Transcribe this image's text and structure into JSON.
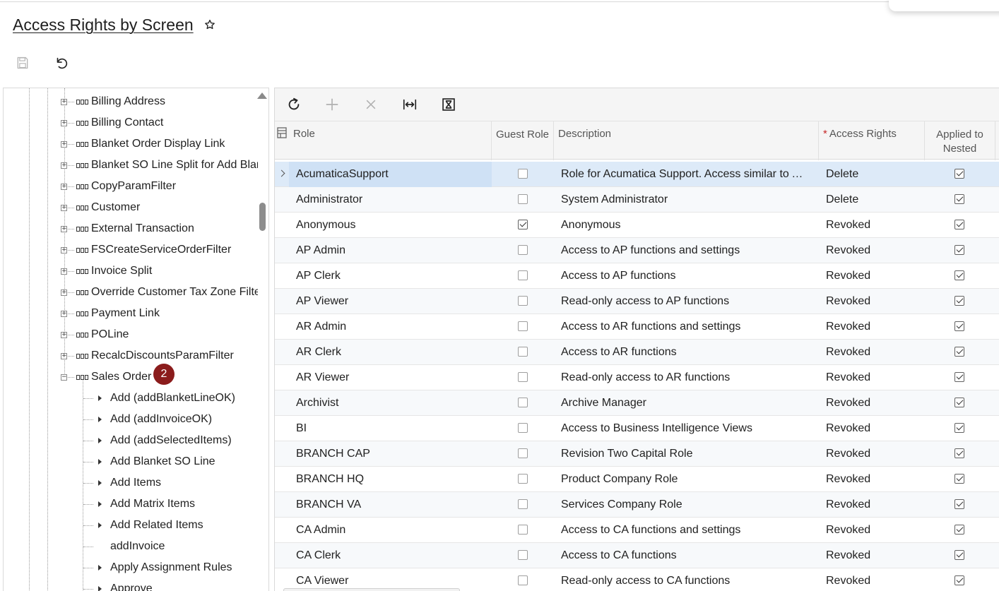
{
  "page": {
    "title": "Access Rights by Screen",
    "icons": {
      "favorite": "star-outline-icon",
      "save": "save-icon",
      "undo": "undo-icon"
    }
  },
  "tree": {
    "tables": [
      {
        "label": "Billing Address",
        "expanded": false
      },
      {
        "label": "Billing Contact",
        "expanded": false
      },
      {
        "label": "Blanket Order Display Link",
        "expanded": false
      },
      {
        "label": "Blanket SO Line Split for Add Blanket",
        "expanded": false
      },
      {
        "label": "CopyParamFilter",
        "expanded": false
      },
      {
        "label": "Customer",
        "expanded": false
      },
      {
        "label": "External Transaction",
        "expanded": false
      },
      {
        "label": "FSCreateServiceOrderFilter",
        "expanded": false
      },
      {
        "label": "Invoice Split",
        "expanded": false
      },
      {
        "label": "Override Customer Tax Zone Filter",
        "expanded": false
      },
      {
        "label": "Payment Link",
        "expanded": false
      },
      {
        "label": "POLine",
        "expanded": false
      },
      {
        "label": "RecalcDiscountsParamFilter",
        "expanded": false
      },
      {
        "label": "Sales Order",
        "expanded": true,
        "badge": "2"
      }
    ],
    "actions": [
      {
        "label": "Add (addBlanketLineOK)",
        "has_children": true
      },
      {
        "label": "Add (addInvoiceOK)",
        "has_children": true
      },
      {
        "label": "Add (addSelectedItems)",
        "has_children": true
      },
      {
        "label": "Add Blanket SO Line",
        "has_children": true
      },
      {
        "label": "Add Items",
        "has_children": true
      },
      {
        "label": "Add Matrix Items",
        "has_children": true
      },
      {
        "label": "Add Related Items",
        "has_children": true
      },
      {
        "label": "addInvoice",
        "has_children": false
      },
      {
        "label": "Apply Assignment Rules",
        "has_children": true
      },
      {
        "label": "Approve",
        "has_children": true
      }
    ]
  },
  "grid": {
    "toolbar_icons": [
      "refresh-icon",
      "add-icon",
      "delete-icon",
      "fit-columns-icon",
      "export-excel-icon"
    ],
    "columns": {
      "role": "Role",
      "guest_role": "Guest Role",
      "description": "Description",
      "access_rights_required": "*",
      "access_rights": "Access Rights",
      "applied_to_nested": "Applied to Nested"
    },
    "rows": [
      {
        "role": "AcumaticaSupport",
        "guest": false,
        "description": "Role for Acumatica Support. Access similar to Administrator",
        "rights": "Delete",
        "nested": true
      },
      {
        "role": "Administrator",
        "guest": false,
        "description": "System Administrator",
        "rights": "Delete",
        "nested": true
      },
      {
        "role": "Anonymous",
        "guest": true,
        "description": "Anonymous",
        "rights": "Revoked",
        "nested": true
      },
      {
        "role": "AP Admin",
        "guest": false,
        "description": "Access to AP functions and settings",
        "rights": "Revoked",
        "nested": true
      },
      {
        "role": "AP Clerk",
        "guest": false,
        "description": "Access to AP functions",
        "rights": "Revoked",
        "nested": true
      },
      {
        "role": "AP Viewer",
        "guest": false,
        "description": "Read-only access to AP functions",
        "rights": "Revoked",
        "nested": true
      },
      {
        "role": "AR Admin",
        "guest": false,
        "description": "Access to AR functions and settings",
        "rights": "Revoked",
        "nested": true
      },
      {
        "role": "AR Clerk",
        "guest": false,
        "description": "Access to AR functions",
        "rights": "Revoked",
        "nested": true
      },
      {
        "role": "AR Viewer",
        "guest": false,
        "description": "Read-only access to AR functions",
        "rights": "Revoked",
        "nested": true
      },
      {
        "role": "Archivist",
        "guest": false,
        "description": "Archive Manager",
        "rights": "Revoked",
        "nested": true
      },
      {
        "role": "BI",
        "guest": false,
        "description": "Access to Business Intelligence Views",
        "rights": "Revoked",
        "nested": true
      },
      {
        "role": "BRANCH CAP",
        "guest": false,
        "description": "Revision Two Capital Role",
        "rights": "Revoked",
        "nested": true
      },
      {
        "role": "BRANCH HQ",
        "guest": false,
        "description": "Product Company Role",
        "rights": "Revoked",
        "nested": true
      },
      {
        "role": "BRANCH VA",
        "guest": false,
        "description": "Services Company Role",
        "rights": "Revoked",
        "nested": true
      },
      {
        "role": "CA Admin",
        "guest": false,
        "description": "Access to CA functions and settings",
        "rights": "Revoked",
        "nested": true
      },
      {
        "role": "CA Clerk",
        "guest": false,
        "description": "Access to CA functions",
        "rights": "Revoked",
        "nested": true
      },
      {
        "role": "CA Viewer",
        "guest": false,
        "description": "Read-only access to CA functions",
        "rights": "Revoked",
        "nested": true
      }
    ]
  }
}
